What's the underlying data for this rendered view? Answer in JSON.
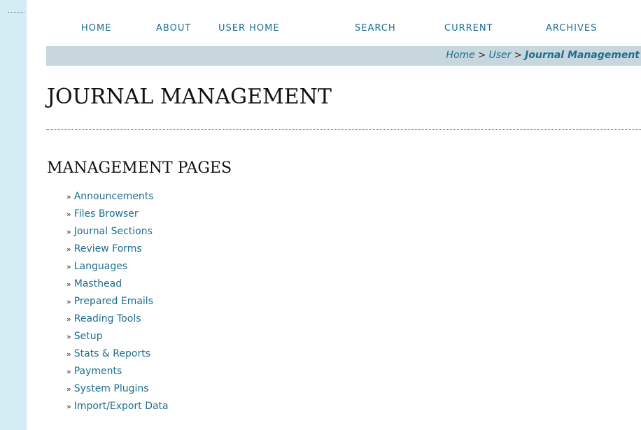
{
  "nav": {
    "home": "HOME",
    "about": "ABOUT",
    "user_home": "USER HOME",
    "search": "SEARCH",
    "current": "CURRENT",
    "archives": "ARCHIVES"
  },
  "breadcrumb": {
    "home": "Home",
    "sep1": ">",
    "user": "User",
    "sep2": ">",
    "current": "Journal Management"
  },
  "page_title": "JOURNAL MANAGEMENT",
  "section_heading": "MANAGEMENT PAGES",
  "bullet": "»",
  "management_pages": [
    "Announcements",
    "Files Browser",
    "Journal Sections",
    "Review Forms",
    "Languages",
    "Masthead",
    "Prepared Emails",
    "Reading Tools",
    "Setup",
    "Stats & Reports",
    "Payments",
    "System Plugins",
    "Import/Export Data"
  ],
  "colors": {
    "link": "#1f6e8f",
    "sidebar": "#d4ecf4",
    "crumb_bar": "#c8d7dd"
  }
}
